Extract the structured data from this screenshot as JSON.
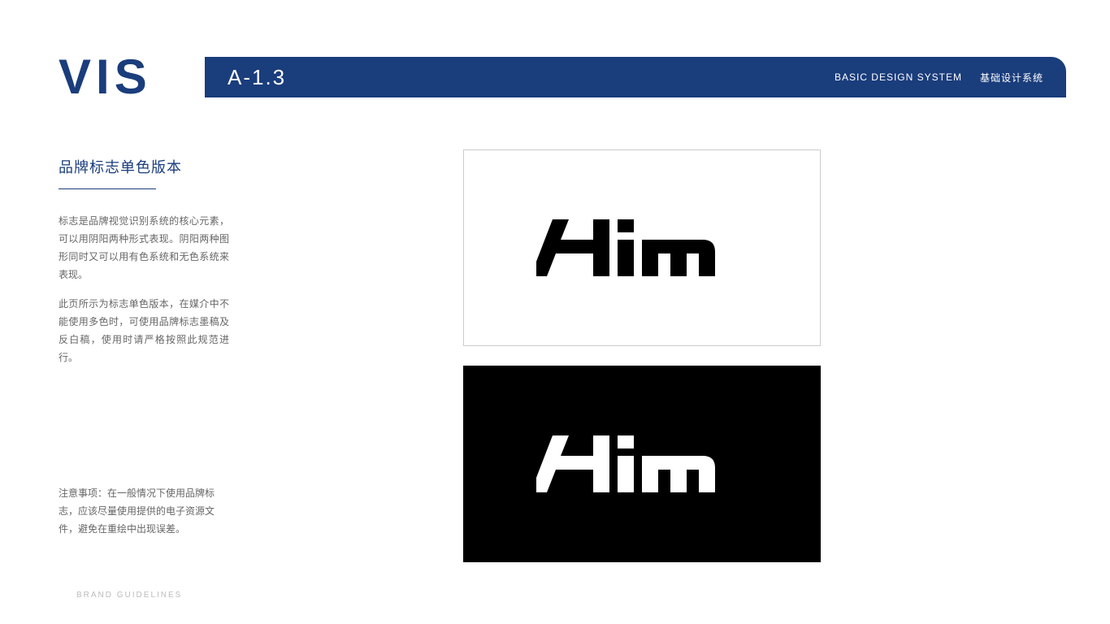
{
  "header": {
    "vis_label": "VIS",
    "section_code": "A-1.3",
    "system_en": "BASIC DESIGN SYSTEM",
    "system_cn": "基础设计系统"
  },
  "left": {
    "title": "品牌标志单色版本",
    "para1": "标志是品牌视觉识别系统的核心元素，可以用阴阳两种形式表现。阴阳两种图形同时又可以用有色系统和无色系统来表现。",
    "para2": "此页所示为标志单色版本，在媒介中不能使用多色时，可使用品牌标志墨稿及反白稿，使用时请严格按照此规范进行。",
    "notice": "注意事项：在一般情况下使用品牌标志，应该尽量使用提供的电子资源文件，避免在重绘中出现误差。"
  },
  "footer": {
    "label": "BRAND GUIDELINES"
  },
  "logo": {
    "name": "Him",
    "variants": [
      "black-on-white",
      "white-on-black"
    ]
  },
  "colors": {
    "brand_blue": "#1a3d7c",
    "black": "#000000",
    "white": "#ffffff"
  }
}
